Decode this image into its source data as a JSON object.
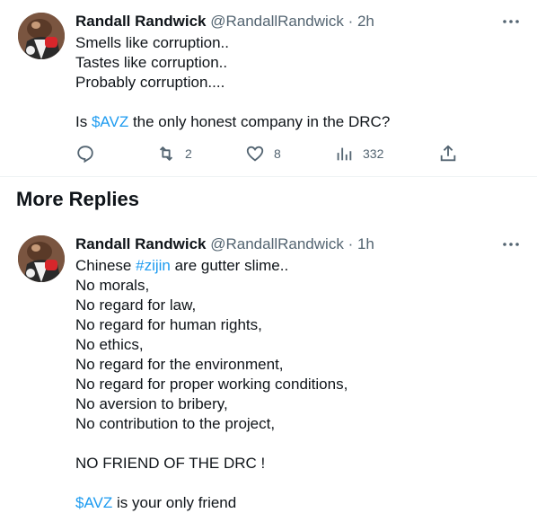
{
  "tweet1": {
    "author_name": "Randall Randwick",
    "handle": "@RandallRandwick",
    "separator": "·",
    "time": "2h",
    "lines": [
      {
        "pre": "Smells like corruption..",
        "link": "",
        "post": ""
      },
      {
        "pre": "Tastes like corruption..",
        "link": "",
        "post": ""
      },
      {
        "pre": "Probably corruption....",
        "link": "",
        "post": ""
      },
      {
        "pre": "",
        "link": "",
        "post": ""
      },
      {
        "pre": "Is ",
        "link": "$AVZ",
        "post": " the only honest company in the DRC?"
      }
    ],
    "actions": {
      "reply_icon": "reply-icon",
      "retweet_icon": "retweet-icon",
      "retweet_count": "2",
      "like_icon": "heart-icon",
      "like_count": "8",
      "views_icon": "views-icon",
      "views_count": "332",
      "share_icon": "share-icon"
    }
  },
  "section": {
    "title": "More Replies"
  },
  "tweet2": {
    "author_name": "Randall Randwick",
    "handle": "@RandallRandwick",
    "separator": "·",
    "time": "1h",
    "lines": [
      {
        "pre": "Chinese ",
        "link": "#zijin",
        "post": " are gutter slime.."
      },
      {
        "pre": "No morals,",
        "link": "",
        "post": ""
      },
      {
        "pre": "No regard for law,",
        "link": "",
        "post": ""
      },
      {
        "pre": "No regard for human rights,",
        "link": "",
        "post": ""
      },
      {
        "pre": "No ethics,",
        "link": "",
        "post": ""
      },
      {
        "pre": "No regard for the environment,",
        "link": "",
        "post": ""
      },
      {
        "pre": "No regard for proper working conditions,",
        "link": "",
        "post": ""
      },
      {
        "pre": "No aversion to bribery,",
        "link": "",
        "post": ""
      },
      {
        "pre": "No contribution to the project,",
        "link": "",
        "post": ""
      },
      {
        "pre": "",
        "link": "",
        "post": ""
      },
      {
        "pre": "NO FRIEND OF THE DRC !",
        "link": "",
        "post": ""
      },
      {
        "pre": "",
        "link": "",
        "post": ""
      },
      {
        "pre": "",
        "link": "$AVZ",
        "post": " is your only friend"
      }
    ]
  },
  "colors": {
    "text": "#0f1419",
    "secondary": "#536471",
    "link": "#1d9bf0",
    "divider": "#eff3f4"
  }
}
